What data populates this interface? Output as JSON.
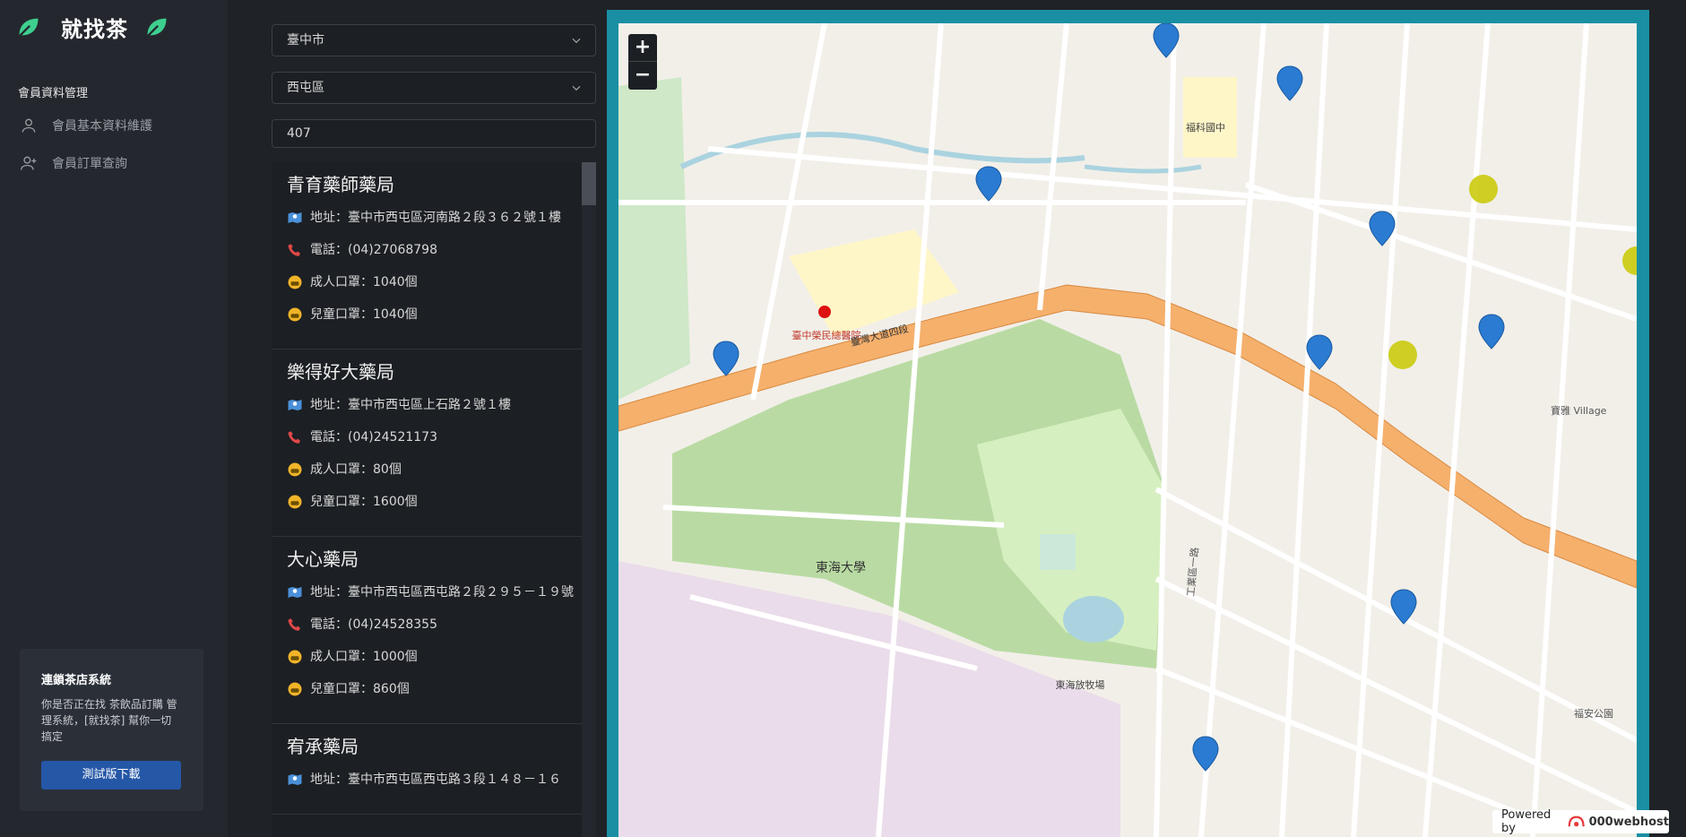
{
  "app": {
    "title": "就找茶"
  },
  "sidebar": {
    "section": "會員資料管理",
    "items": [
      {
        "label": "會員基本資料維護",
        "icon": "user-icon"
      },
      {
        "label": "會員訂單查詢",
        "icon": "user-plus-icon"
      }
    ],
    "promo": {
      "title": "連鎖茶店系統",
      "text": "你是否正在找 茶飲品訂購 管理系統，[就找茶] 幫你一切搞定",
      "button": "測試版下載"
    }
  },
  "filters": {
    "city": "臺中市",
    "district": "西屯區",
    "search": "407"
  },
  "stores": [
    {
      "name": "青育藥師藥局",
      "address": "地址：臺中市西屯區河南路２段３６２號１樓",
      "phone": "電話：(04)27068798",
      "adult": "成人口罩：1040個",
      "child": "兒童口罩：1040個"
    },
    {
      "name": "樂得好大藥局",
      "address": "地址：臺中市西屯區上石路２號１樓",
      "phone": "電話：(04)24521173",
      "adult": "成人口罩：80個",
      "child": "兒童口罩：1600個"
    },
    {
      "name": "大心藥局",
      "address": "地址：臺中市西屯區西屯路２段２９５－１９號",
      "phone": "電話：(04)24528355",
      "adult": "成人口罩：1000個",
      "child": "兒童口罩：860個"
    },
    {
      "name": "宥承藥局",
      "address": "地址：臺中市西屯區西屯路３段１４８－１６",
      "phone": "",
      "adult": "",
      "child": ""
    }
  ],
  "map": {
    "zoom_in": "+",
    "zoom_out": "−",
    "labels": [
      "臺灣大道四段",
      "東海大學",
      "東海放牧場",
      "福科國中",
      "臺中榮民總醫院",
      "寶雅 Village",
      "工業區一路",
      "福安公園"
    ],
    "attribution_prefix": "Powered by",
    "attribution_brand": "000webhost",
    "colors": {
      "frame": "#1a8fa3",
      "marker": "#2a7bd1",
      "road": "#f5b06c"
    }
  }
}
